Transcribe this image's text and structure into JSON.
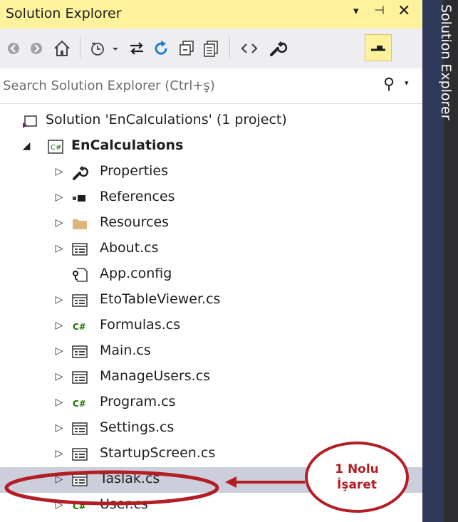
{
  "panel": {
    "title": "Solution Explorer",
    "side_tab_label": "Solution Explorer",
    "accent": "#fff29d",
    "side_tab_color": "#2f3a5a"
  },
  "title_buttons": [
    {
      "name": "window-position-menu",
      "icon": "dropdown-arrow-icon",
      "glyph": "▾"
    },
    {
      "name": "auto-hide-pin",
      "icon": "pin-icon",
      "glyph": "⊣"
    },
    {
      "name": "close",
      "icon": "close-icon",
      "glyph": "✕"
    }
  ],
  "toolbar": [
    {
      "name": "back",
      "icon": "back-arrow-icon"
    },
    {
      "name": "forward",
      "icon": "forward-arrow-icon"
    },
    {
      "name": "home",
      "icon": "home-icon"
    },
    {
      "name": "pending-changes-filter",
      "icon": "clock-filter-icon"
    },
    {
      "name": "sync-with-active-document",
      "icon": "sync-arrows-icon"
    },
    {
      "name": "refresh",
      "icon": "refresh-icon"
    },
    {
      "name": "collapse-all",
      "icon": "collapse-all-icon"
    },
    {
      "name": "show-all-files",
      "icon": "show-all-files-icon"
    },
    {
      "name": "view-code",
      "icon": "code-brackets-icon"
    },
    {
      "name": "properties",
      "icon": "wrench-icon"
    },
    {
      "name": "preview-selected-items",
      "icon": "preview-toggle-icon",
      "active": true
    }
  ],
  "search": {
    "placeholder": "Search Solution Explorer (Ctrl+ş)",
    "icon": "search-icon"
  },
  "tree": {
    "solution": {
      "label": "Solution 'EnCalculations' (1 project)",
      "icon": "solution-icon"
    },
    "project": {
      "label": "EnCalculations",
      "icon": "csharp-project-icon",
      "expanded": true
    },
    "items": [
      {
        "label": "Properties",
        "icon": "wrench-icon",
        "expandable": true
      },
      {
        "label": "References",
        "icon": "references-icon",
        "expandable": true
      },
      {
        "label": "Resources",
        "icon": "folder-icon",
        "expandable": true
      },
      {
        "label": "About.cs",
        "icon": "form-icon",
        "expandable": true
      },
      {
        "label": "App.config",
        "icon": "config-file-icon",
        "expandable": false
      },
      {
        "label": "EtoTableViewer.cs",
        "icon": "form-icon",
        "expandable": true
      },
      {
        "label": "Formulas.cs",
        "icon": "csharp-file-icon",
        "expandable": true
      },
      {
        "label": "Main.cs",
        "icon": "form-icon",
        "expandable": true
      },
      {
        "label": "ManageUsers.cs",
        "icon": "form-icon",
        "expandable": true
      },
      {
        "label": "Program.cs",
        "icon": "csharp-file-icon",
        "expandable": true
      },
      {
        "label": "Settings.cs",
        "icon": "form-icon",
        "expandable": true
      },
      {
        "label": "StartupScreen.cs",
        "icon": "form-icon",
        "expandable": true
      },
      {
        "label": "Taslak.cs",
        "icon": "form-icon",
        "expandable": true,
        "selected": true
      },
      {
        "label": "User.cs",
        "icon": "csharp-file-icon",
        "expandable": true
      }
    ]
  },
  "annotation": {
    "line1": "1 Nolu",
    "line2": "İşaret",
    "color": "#b31e24"
  }
}
